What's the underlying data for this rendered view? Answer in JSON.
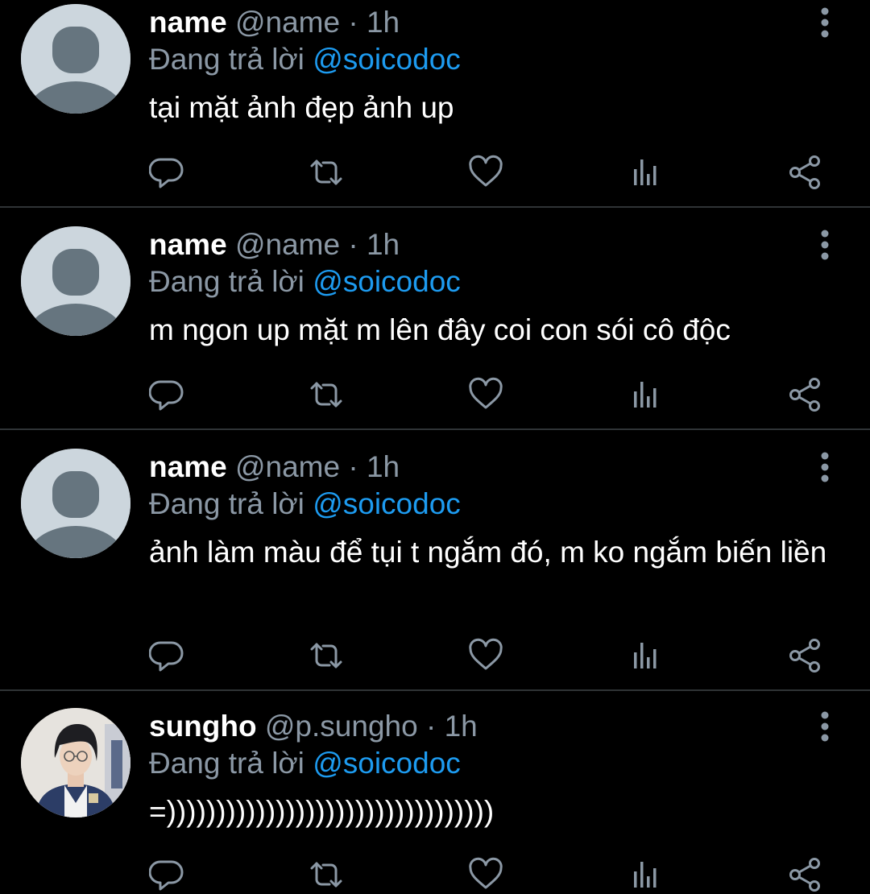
{
  "tweets": [
    {
      "display_name": "name",
      "handle": "@name",
      "separator": "·",
      "time": "1h",
      "reply_prefix": "Đang trả lời",
      "reply_to": "@soicodoc",
      "text": "tại mặt ảnh đẹp ảnh up",
      "avatar": "default-avatar"
    },
    {
      "display_name": "name",
      "handle": "@name",
      "separator": "·",
      "time": "1h",
      "reply_prefix": "Đang trả lời",
      "reply_to": "@soicodoc",
      "text": "m ngon up mặt m lên đây coi con sói cô độc",
      "avatar": "default-avatar"
    },
    {
      "display_name": "name",
      "handle": "@name",
      "separator": "·",
      "time": "1h",
      "reply_prefix": "Đang trả lời",
      "reply_to": "@soicodoc",
      "text": "ảnh làm màu để tụi t ngắm đó, m ko ngắm biến liền",
      "avatar": "default-avatar"
    },
    {
      "display_name": "sungho",
      "handle": "@p.sungho",
      "separator": "·",
      "time": "1h",
      "reply_prefix": "Đang trả lời",
      "reply_to": "@soicodoc",
      "text": "=)))))))))))))))))))))))))))))))))",
      "avatar": "photo-avatar"
    }
  ],
  "icons": {
    "reply": "reply-icon",
    "retweet": "retweet-icon",
    "like": "heart-icon",
    "analytics": "analytics-icon",
    "share": "share-icon",
    "more": "more-vertical-icon"
  },
  "colors": {
    "background": "#000000",
    "text": "#ffffff",
    "muted": "#8b98a5",
    "mention": "#1d9bf0",
    "divider": "#2f3336"
  }
}
